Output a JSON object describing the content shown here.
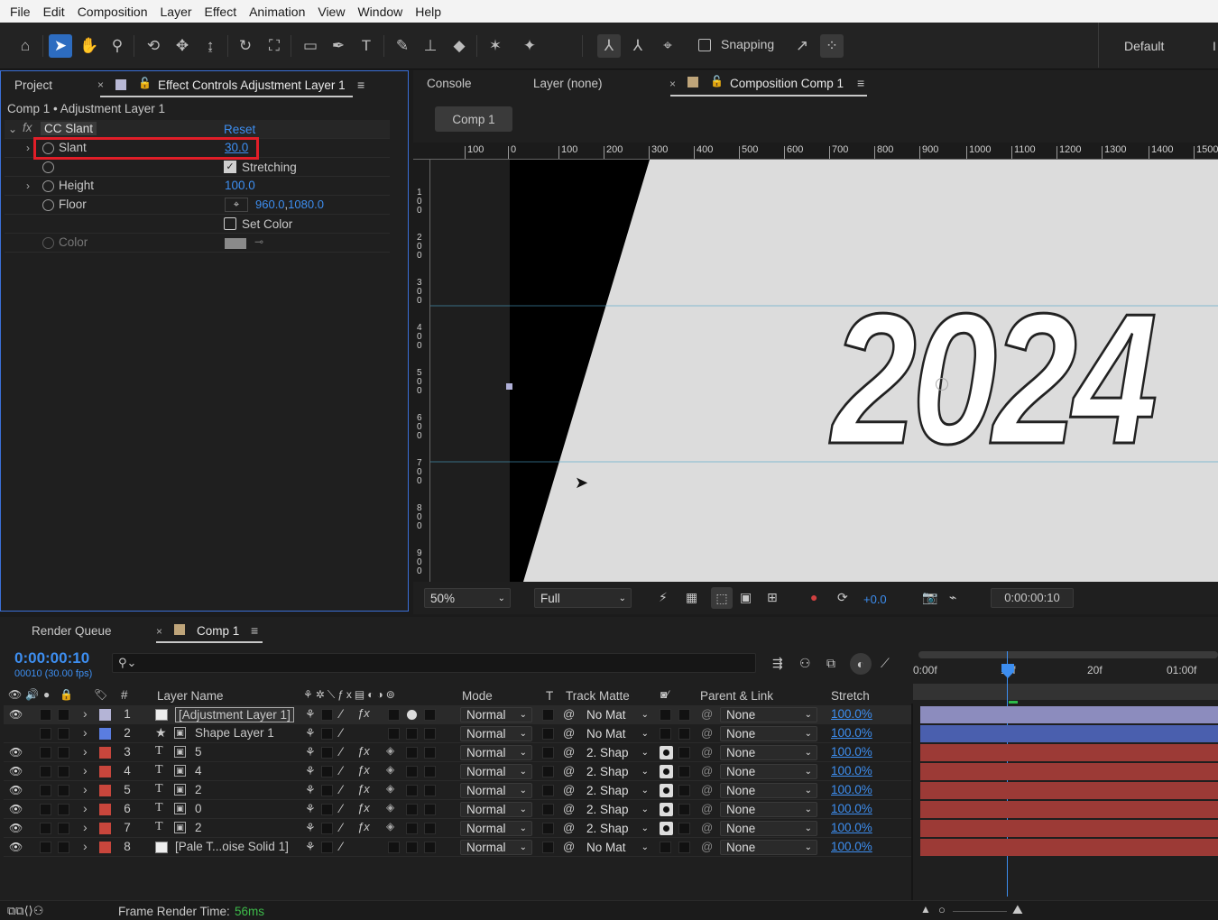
{
  "menu": [
    "File",
    "Edit",
    "Composition",
    "Layer",
    "Effect",
    "Animation",
    "View",
    "Window",
    "Help"
  ],
  "toolbar": {
    "snapping": "Snapping",
    "workspace": "Default",
    "workspace_more": "I"
  },
  "project_panel": {
    "tab_project": "Project",
    "tab_effect": "Effect Controls Adjustment Layer 1",
    "breadcrumb": "Comp 1 • Adjustment Layer 1",
    "effect_name": "CC Slant",
    "reset": "Reset",
    "properties": [
      {
        "name": "Slant",
        "value": "30.0"
      },
      {
        "name": "",
        "value": "Stretching"
      },
      {
        "name": "Height",
        "value": "100.0"
      },
      {
        "name": "Floor",
        "value_x": "960.0",
        "value_sep": ",",
        "value_y": "1080.0"
      },
      {
        "name": "",
        "value": "Set Color"
      },
      {
        "name": "Color",
        "value": ""
      }
    ]
  },
  "viewer": {
    "tab_console": "Console",
    "tab_layer": "Layer (none)",
    "tab_comp": "Composition Comp 1",
    "comp_button": "Comp 1",
    "ruler_h": [
      "100",
      "0",
      "100",
      "200",
      "300",
      "400",
      "500",
      "600",
      "700",
      "800",
      "900",
      "1000",
      "1100",
      "1200",
      "1300",
      "1400",
      "1500"
    ],
    "ruler_v": [
      [
        "1",
        "0",
        "0"
      ],
      [
        "2",
        "0",
        "0"
      ],
      [
        "3",
        "0",
        "0"
      ],
      [
        "4",
        "0",
        "0"
      ],
      [
        "5",
        "0",
        "0"
      ],
      [
        "6",
        "0",
        "0"
      ],
      [
        "7",
        "0",
        "0"
      ],
      [
        "8",
        "0",
        "0"
      ],
      [
        "9",
        "0",
        "0"
      ]
    ],
    "text": "2024",
    "zoom": "50%",
    "resolution": "Full",
    "exposure": "+0.0",
    "timecode": "0:00:00:10"
  },
  "timeline": {
    "tab_render": "Render Queue",
    "tab_comp": "Comp 1",
    "timecode": "0:00:00:10",
    "frames": "00010 (30.00 fps)",
    "headers": {
      "num": "#",
      "name": "Layer Name",
      "mode": "Mode",
      "t": "T",
      "track": "Track Matte",
      "parent": "Parent & Link",
      "stretch": "Stretch"
    },
    "ruler": [
      "0:00f",
      "10f",
      "20f",
      "01:00f"
    ],
    "layers": [
      {
        "num": "1",
        "name": "[Adjustment Layer 1]",
        "mode": "Normal",
        "track": "No Mat",
        "parent": "None",
        "stretch": "100.0%",
        "color": "#b4b4d6"
      },
      {
        "num": "2",
        "name": "Shape Layer 1",
        "mode": "Normal",
        "track": "No Mat",
        "parent": "None",
        "stretch": "100.0%",
        "color": "#5a7de0"
      },
      {
        "num": "3",
        "name": "5",
        "mode": "Normal",
        "track": "2. Shap",
        "parent": "None",
        "stretch": "100.0%",
        "color": "#c8463c"
      },
      {
        "num": "4",
        "name": "4",
        "mode": "Normal",
        "track": "2. Shap",
        "parent": "None",
        "stretch": "100.0%",
        "color": "#c8463c"
      },
      {
        "num": "5",
        "name": "2",
        "mode": "Normal",
        "track": "2. Shap",
        "parent": "None",
        "stretch": "100.0%",
        "color": "#c8463c"
      },
      {
        "num": "6",
        "name": "0",
        "mode": "Normal",
        "track": "2. Shap",
        "parent": "None",
        "stretch": "100.0%",
        "color": "#c8463c"
      },
      {
        "num": "7",
        "name": "2",
        "mode": "Normal",
        "track": "2. Shap",
        "parent": "None",
        "stretch": "100.0%",
        "color": "#c8463c"
      },
      {
        "num": "8",
        "name": "[Pale T...oise Solid 1]",
        "mode": "Normal",
        "track": "No Mat",
        "parent": "None",
        "stretch": "100.0%",
        "color": "#c8463c"
      }
    ],
    "footer_label": "Frame Render Time:",
    "footer_value": "56ms"
  }
}
